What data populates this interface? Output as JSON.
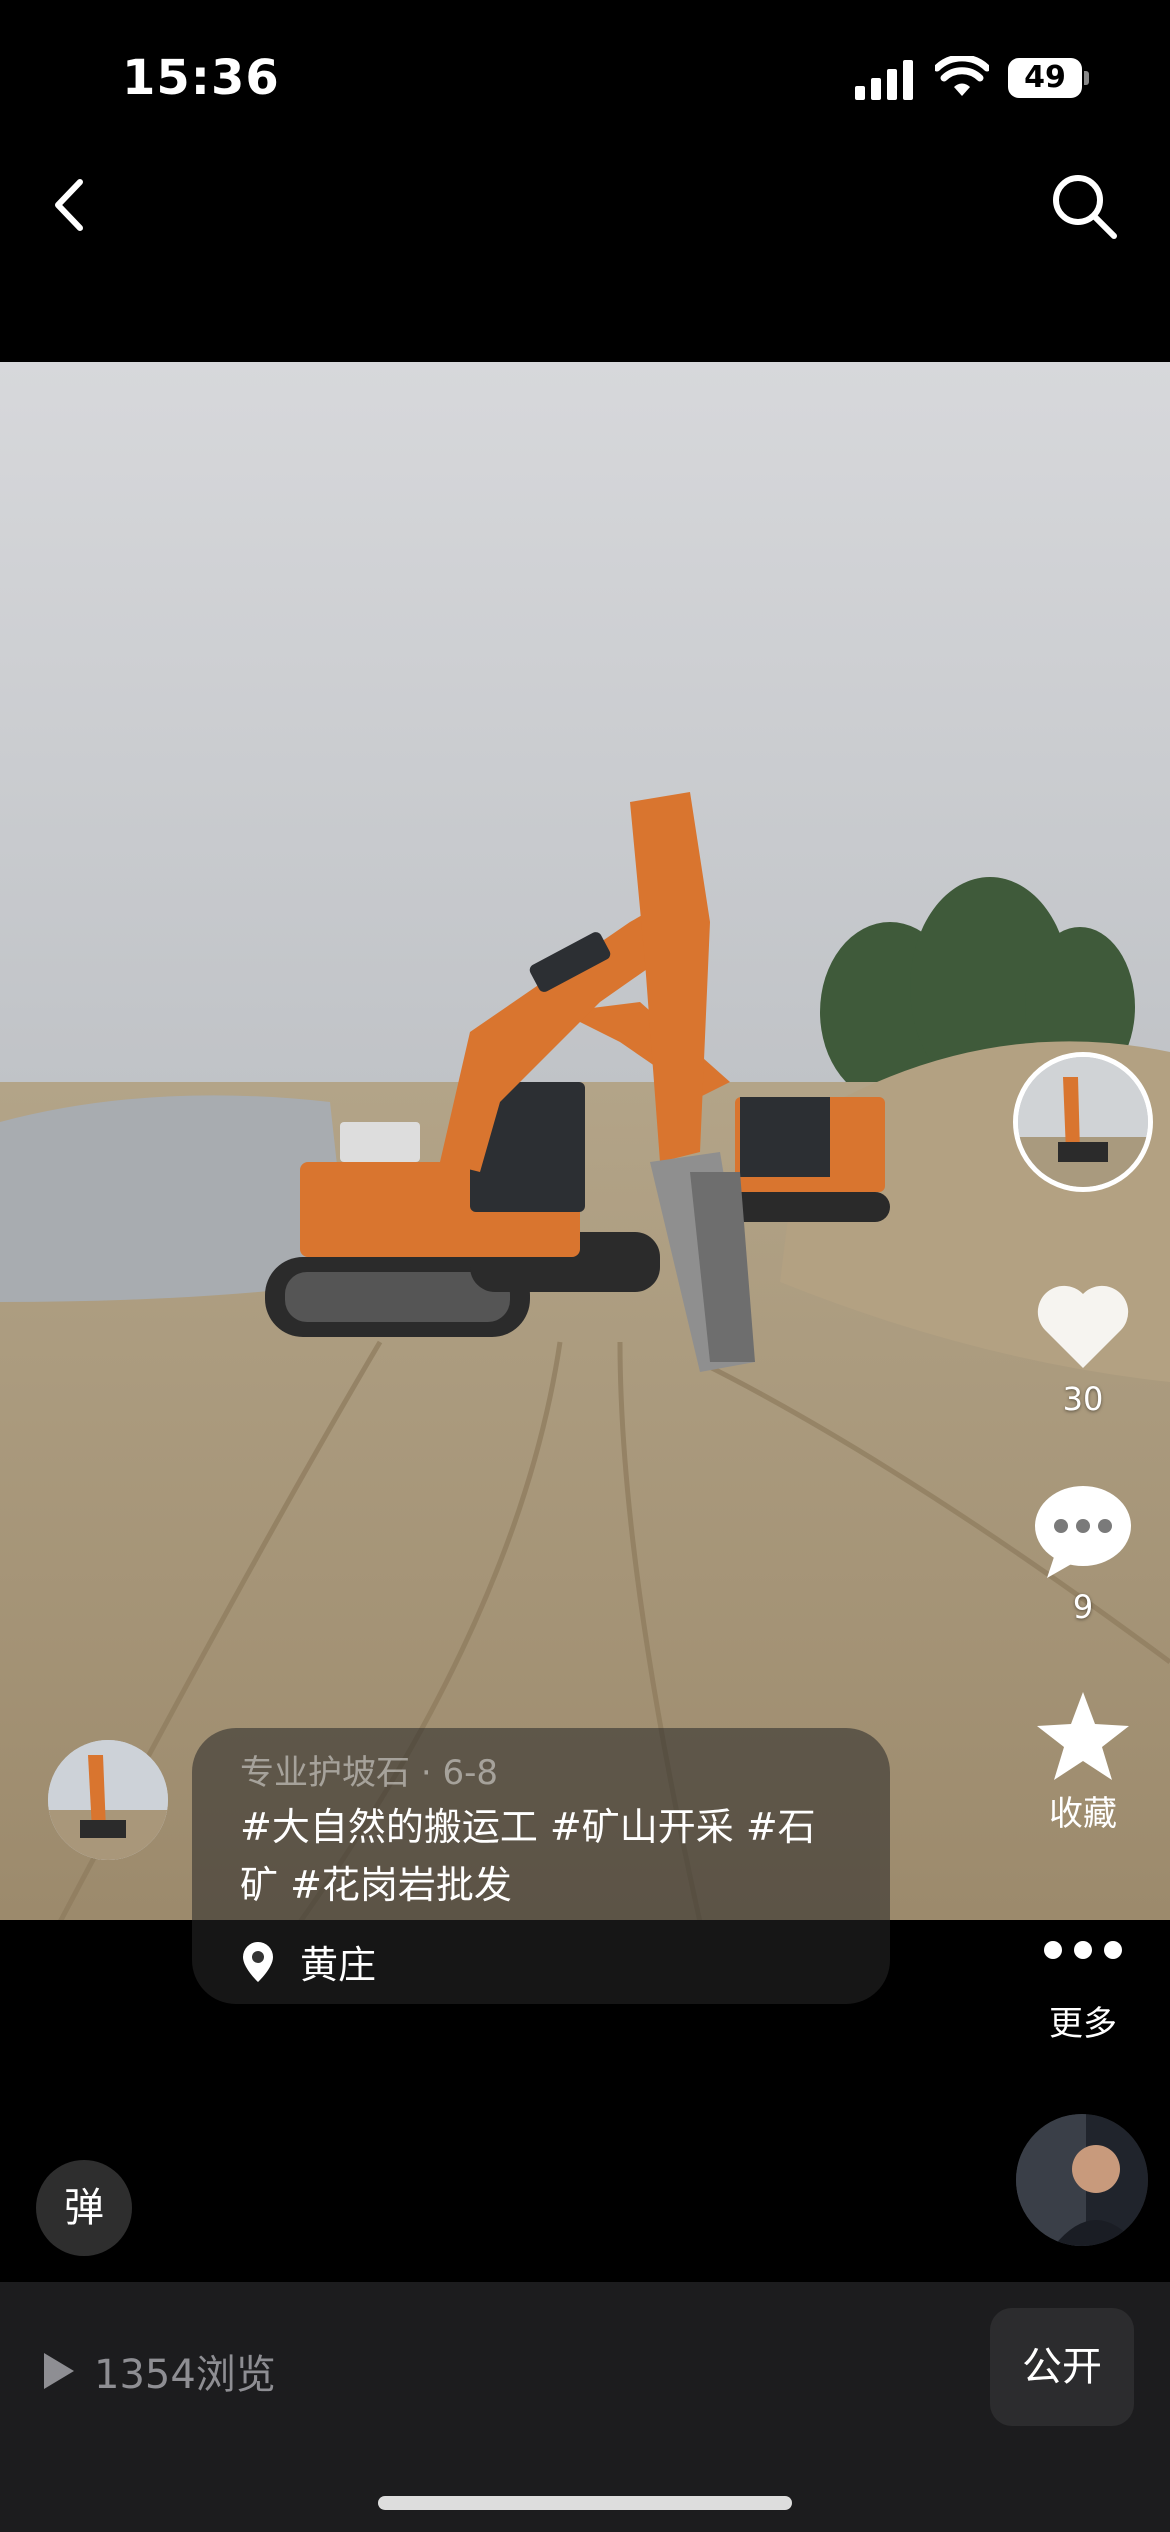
{
  "status_bar": {
    "time": "15:36",
    "battery": "49"
  },
  "post": {
    "author": "专业护坡石",
    "date": "6-8",
    "caption": "#大自然的搬运工 #矿山开采 #石矿 #花岗岩批发",
    "location": "黄庄",
    "likes": "30",
    "comments": "9",
    "favorite_label": "收藏",
    "more_label": "更多"
  },
  "bottom": {
    "danmu_label": "弹",
    "views": "1354浏览",
    "public_label": "公开"
  },
  "icons": {
    "back": "chevron-left-icon",
    "search": "search-icon",
    "like": "heart-icon",
    "comment": "comment-bubble-icon",
    "favorite": "star-icon",
    "more": "ellipsis-icon",
    "location": "map-pin-icon",
    "play": "play-icon"
  },
  "colors": {
    "background": "#000000",
    "bottom_bar": "#1c1c1e",
    "secondary_text": "#8e8e93",
    "excavator": "#d9752f"
  }
}
